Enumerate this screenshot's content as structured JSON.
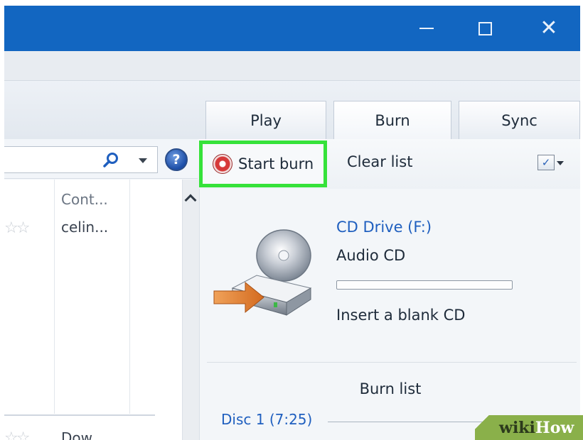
{
  "tabs": {
    "play": "Play",
    "burn": "Burn",
    "sync": "Sync"
  },
  "toolbar": {
    "start_burn": "Start burn",
    "clear_list": "Clear list"
  },
  "help": {
    "glyph": "?"
  },
  "library": {
    "column_header": "Cont...",
    "rows": [
      {
        "rating_glyph": "☆☆",
        "contributing_artist": "celin..."
      }
    ],
    "partial_bottom_text": "Dow..."
  },
  "burn_pane": {
    "drive_name": "CD Drive (F:)",
    "disc_type": "Audio CD",
    "progress": 0,
    "status": "Insert a blank CD",
    "burn_list_title": "Burn list",
    "disc_label": "Disc 1 (7:25)"
  },
  "watermark": {
    "part1": "wiki",
    "part2": "How"
  },
  "icons": {
    "minimize": "minimize-icon",
    "maximize": "maximize-icon",
    "close": "close-icon",
    "search": "magnifier-icon",
    "help": "help-icon",
    "burn": "burn-disc-icon",
    "options": "list-options-icon",
    "device": "cd-drive-icon"
  },
  "colors": {
    "titlebar": "#1266c1",
    "highlight": "#36e23a",
    "link": "#1f5fbf"
  }
}
